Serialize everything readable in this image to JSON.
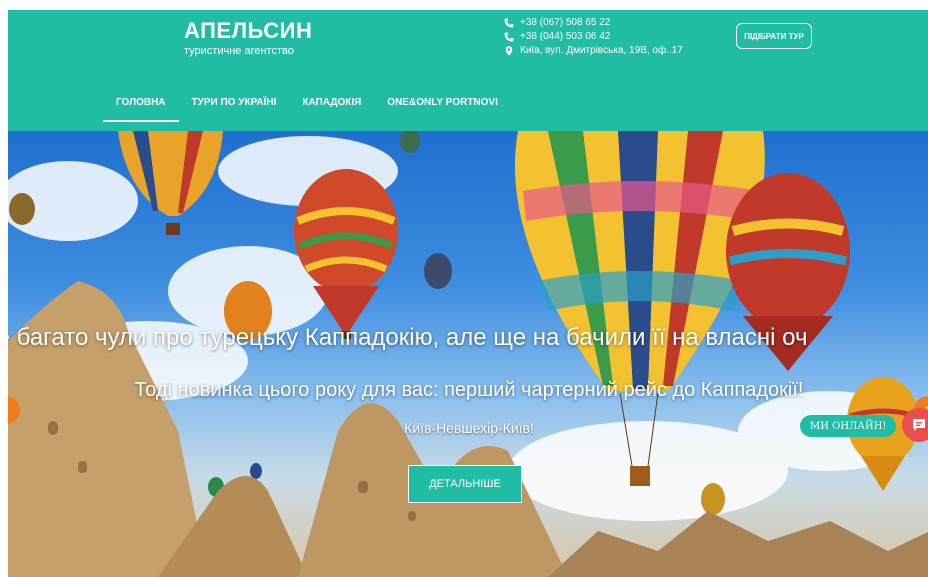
{
  "header": {
    "brand_name": "АПЕЛЬСИН",
    "brand_sub": "туристичне агентство",
    "phone1": "+38 (067) 508 65 22",
    "phone2": "+38 (044) 503 06 42",
    "address": "Київ, вул. Дмитрівська, 19В, оф..17",
    "pick_tour_label": "ПІДІБРАТИ ТУР",
    "accent_color": "#21bca4"
  },
  "nav": {
    "items": [
      {
        "label": "ГОЛОВНА",
        "active": true
      },
      {
        "label": "ТУРИ ПО УКРАЇНІ"
      },
      {
        "label": "КАПАДОКІЯ"
      },
      {
        "label": "ONE&ONLY PORTNOVI"
      }
    ]
  },
  "hero": {
    "headline": "и вже багато чули про турецьку Каппадокію, але ще на бачили її на власні оч",
    "subline": "Тоді новинка цього року для вас: перший чартерний рейс до Каппадокії!",
    "route": "Київ-Невшехір-Київ!",
    "details_label": "ДЕТАЛЬНІШЕ",
    "arrow_color": "#f07c1b"
  },
  "chat": {
    "online_label": "МИ ОНЛАЙН!",
    "chat_color": "#e94f4f"
  }
}
